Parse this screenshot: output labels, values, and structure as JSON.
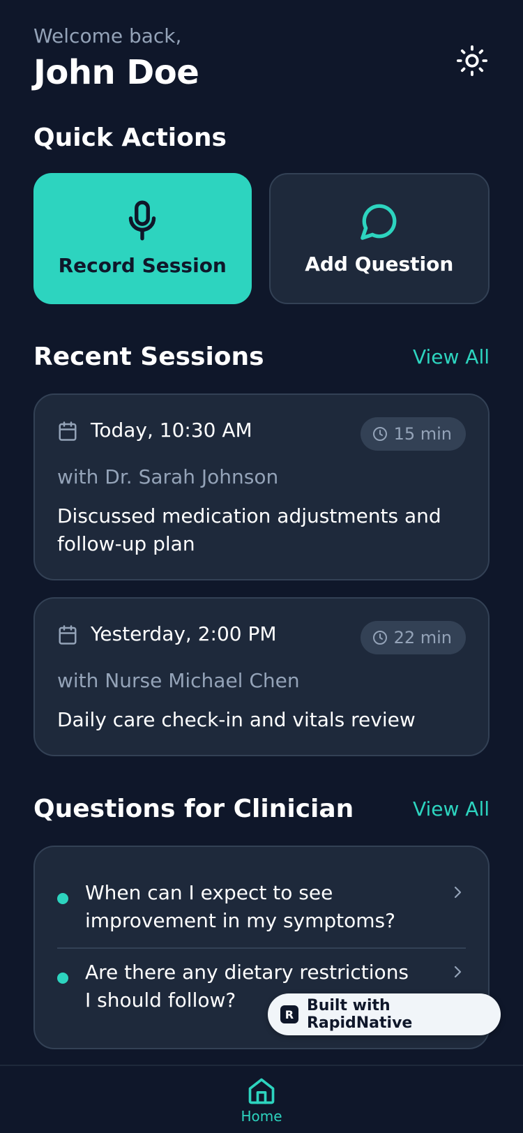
{
  "header": {
    "welcome": "Welcome back,",
    "user_name": "John Doe",
    "theme_icon": "sun-icon"
  },
  "quick_actions": {
    "title": "Quick Actions",
    "record": {
      "label": "Record Session",
      "icon": "microphone-icon"
    },
    "question": {
      "label": "Add Question",
      "icon": "chat-bubble-icon"
    }
  },
  "recent_sessions": {
    "title": "Recent Sessions",
    "view_all": "View All",
    "items": [
      {
        "time": "Today, 10:30 AM",
        "duration": "15 min",
        "clinician": "with Dr. Sarah Johnson",
        "summary": "Discussed medication adjustments and follow-up plan"
      },
      {
        "time": "Yesterday, 2:00 PM",
        "duration": "22 min",
        "clinician": "with Nurse Michael Chen",
        "summary": "Daily care check-in and vitals review"
      }
    ]
  },
  "questions": {
    "title": "Questions for Clinician",
    "view_all": "View All",
    "items": [
      {
        "text": "When can I expect to see improvement in my symptoms?"
      },
      {
        "text": "Are there any dietary restrictions I should follow?"
      }
    ]
  },
  "badge": {
    "logo": "R",
    "label": "Built with RapidNative"
  },
  "tabbar": {
    "home_label": "Home"
  },
  "colors": {
    "background": "#0f172a",
    "card": "#1e293b",
    "border": "#334155",
    "accent": "#2dd4bf",
    "muted": "#94a3b8"
  }
}
